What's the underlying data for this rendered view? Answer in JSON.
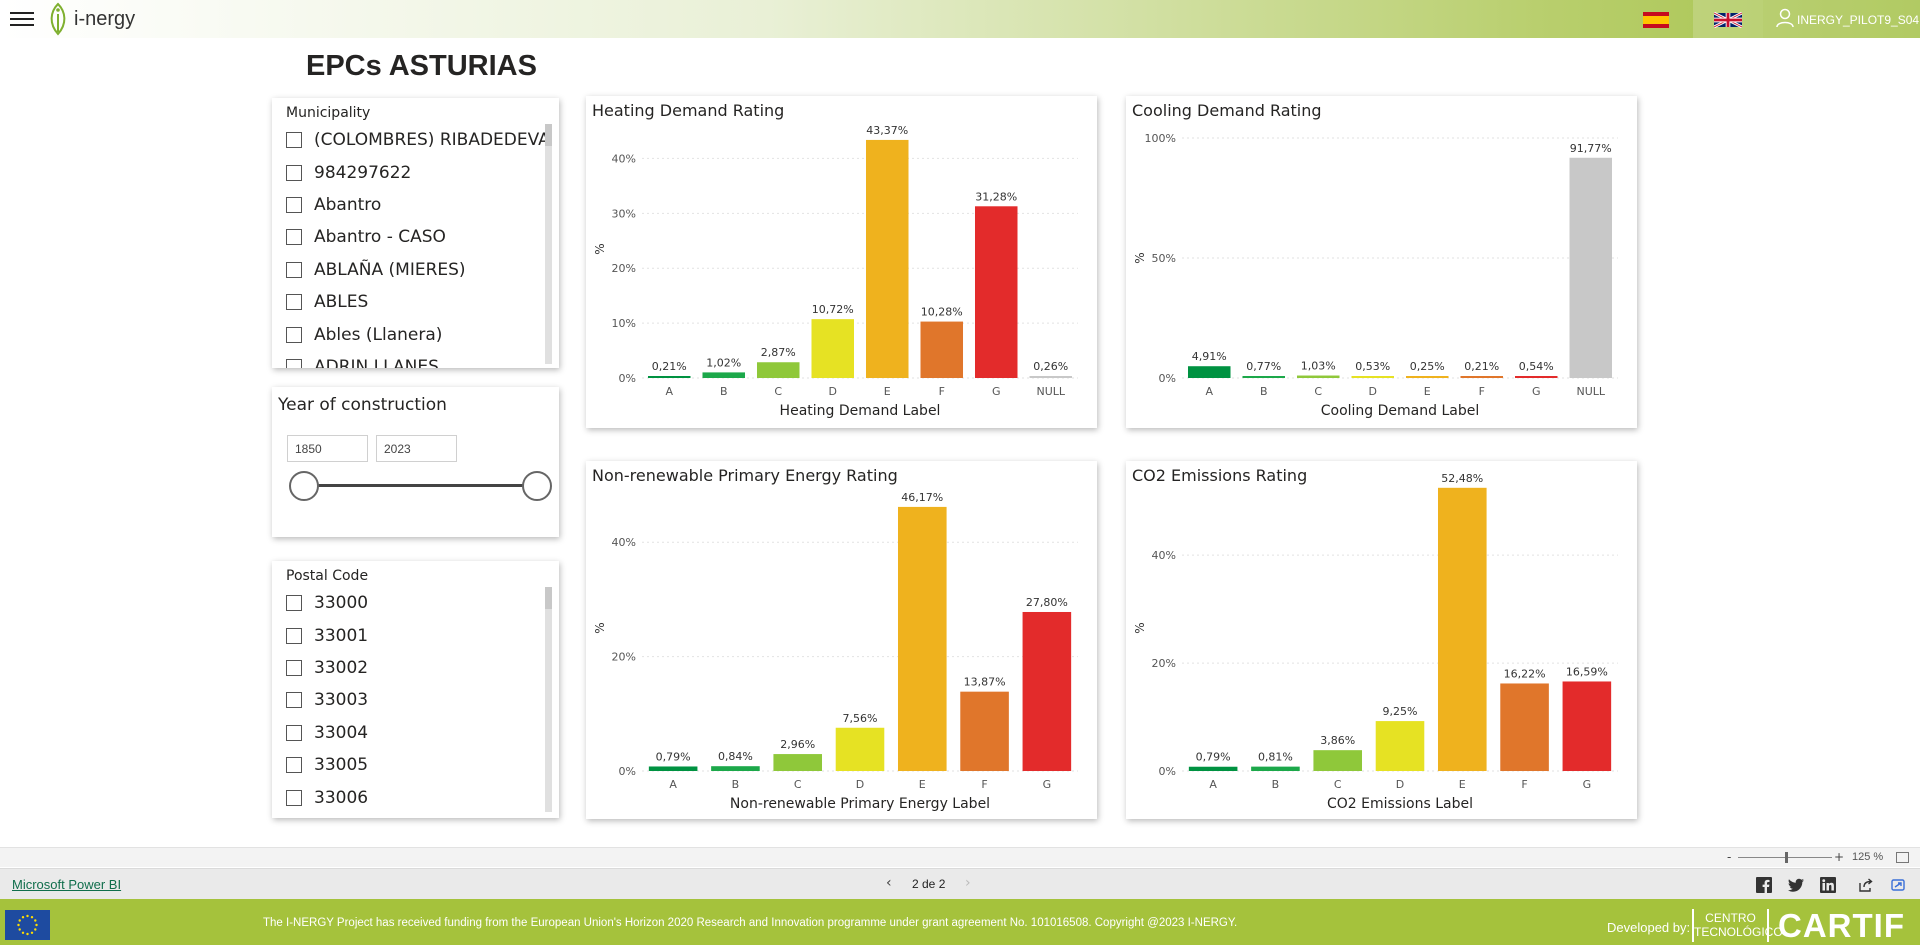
{
  "header": {
    "logo_text": "i-nergy",
    "user_name": "INERGY_PILOT9_S04",
    "lang_es": "Spanish flag",
    "lang_en": "UK flag"
  },
  "page_title": "EPCs ASTURIAS",
  "municipality": {
    "title": "Municipality",
    "items": [
      "(COLOMBRES) RIBADEDEVA",
      "984297622",
      "Abantro",
      "Abantro - CASO",
      "ABLAÑA (MIERES)",
      "ABLES",
      "Ables (Llanera)",
      "ADRIN LLANES"
    ]
  },
  "year": {
    "title": "Year of construction",
    "from": "1850",
    "to": "2023",
    "range": [
      1850,
      2023
    ],
    "selected": [
      1850,
      2023
    ]
  },
  "postal_code": {
    "title": "Postal Code",
    "items": [
      "33000",
      "33001",
      "33002",
      "33003",
      "33004",
      "33005",
      "33006"
    ]
  },
  "colors": {
    "A": "#009241",
    "B": "#1ca84a",
    "C": "#8fc83a",
    "D": "#e6e223",
    "E": "#efb21e",
    "F": "#e0762b",
    "G": "#e32b2b",
    "NULL": "#c8c8c8",
    "axis_text": "#555555",
    "grid": "#e2e2e2",
    "accent": "#a5c23c"
  },
  "chart_data": [
    {
      "type": "bar",
      "title": "Heating Demand Rating",
      "xlabel": "Heating Demand Label",
      "ylabel": "%",
      "categories": [
        "A",
        "B",
        "C",
        "D",
        "E",
        "F",
        "G",
        "NULL"
      ],
      "values": [
        0.21,
        1.02,
        2.87,
        10.72,
        43.37,
        10.28,
        31.28,
        0.26
      ],
      "labels": [
        "0,21%",
        "1,02%",
        "2,87%",
        "10,72%",
        "43,37%",
        "10,28%",
        "31,28%",
        "0,26%"
      ],
      "yticks": [
        0,
        10,
        20,
        30,
        40
      ],
      "ytick_labels": [
        "0%",
        "10%",
        "20%",
        "30%",
        "40%"
      ],
      "ylim": [
        0,
        47
      ],
      "grid": true
    },
    {
      "type": "bar",
      "title": "Cooling Demand Rating",
      "xlabel": "Cooling Demand Label",
      "ylabel": "%",
      "categories": [
        "A",
        "B",
        "C",
        "D",
        "E",
        "F",
        "G",
        "NULL"
      ],
      "values": [
        4.91,
        0.77,
        1.03,
        0.53,
        0.25,
        0.21,
        0.54,
        91.77
      ],
      "labels": [
        "4,91%",
        "0,77%",
        "1,03%",
        "0,53%",
        "0,25%",
        "0,21%",
        "0,54%",
        "91,77%"
      ],
      "yticks": [
        0,
        50,
        100
      ],
      "ytick_labels": [
        "0%",
        "50%",
        "100%"
      ],
      "ylim": [
        0,
        100
      ],
      "grid": true
    },
    {
      "type": "bar",
      "title": "Non-renewable Primary Energy Rating",
      "xlabel": "Non-renewable Primary Energy Label",
      "ylabel": "%",
      "categories": [
        "A",
        "B",
        "C",
        "D",
        "E",
        "F",
        "G"
      ],
      "values": [
        0.79,
        0.84,
        2.96,
        7.56,
        46.17,
        13.87,
        27.8
      ],
      "labels": [
        "0,79%",
        "0,84%",
        "2,96%",
        "7,56%",
        "46,17%",
        "13,87%",
        "27,80%"
      ],
      "yticks": [
        0,
        20,
        40
      ],
      "ytick_labels": [
        "0%",
        "20%",
        "40%"
      ],
      "ylim": [
        0,
        50
      ],
      "grid": true
    },
    {
      "type": "bar",
      "title": "CO2 Emissions Rating",
      "xlabel": "CO2 Emissions Label",
      "ylabel": "%",
      "categories": [
        "A",
        "B",
        "C",
        "D",
        "E",
        "F",
        "G"
      ],
      "values": [
        0.79,
        0.81,
        3.86,
        9.25,
        52.48,
        16.22,
        16.59
      ],
      "labels": [
        "0,79%",
        "0,81%",
        "3,86%",
        "9,25%",
        "52,48%",
        "16,22%",
        "16,59%"
      ],
      "yticks": [
        0,
        20,
        40
      ],
      "ytick_labels": [
        "0%",
        "20%",
        "40%"
      ],
      "ylim": [
        0,
        53
      ],
      "grid": true
    }
  ],
  "zoom": {
    "minus": "-",
    "plus": "+",
    "level": "125 %"
  },
  "pager": {
    "link": "Microsoft Power BI",
    "indicator": "2 de 2",
    "prev": "‹",
    "next": "›"
  },
  "footer": {
    "text": "The I-NERGY Project has received funding from the European Union's Horizon 2020 Research and Innovation programme under grant agreement No. 101016508. Copyright @2023 I-NERGY.",
    "developed_by": "Developed by:",
    "centro_line1": "CENTRO",
    "centro_line2": "TECNOLÓGICO",
    "cartif": "CARTIF"
  }
}
